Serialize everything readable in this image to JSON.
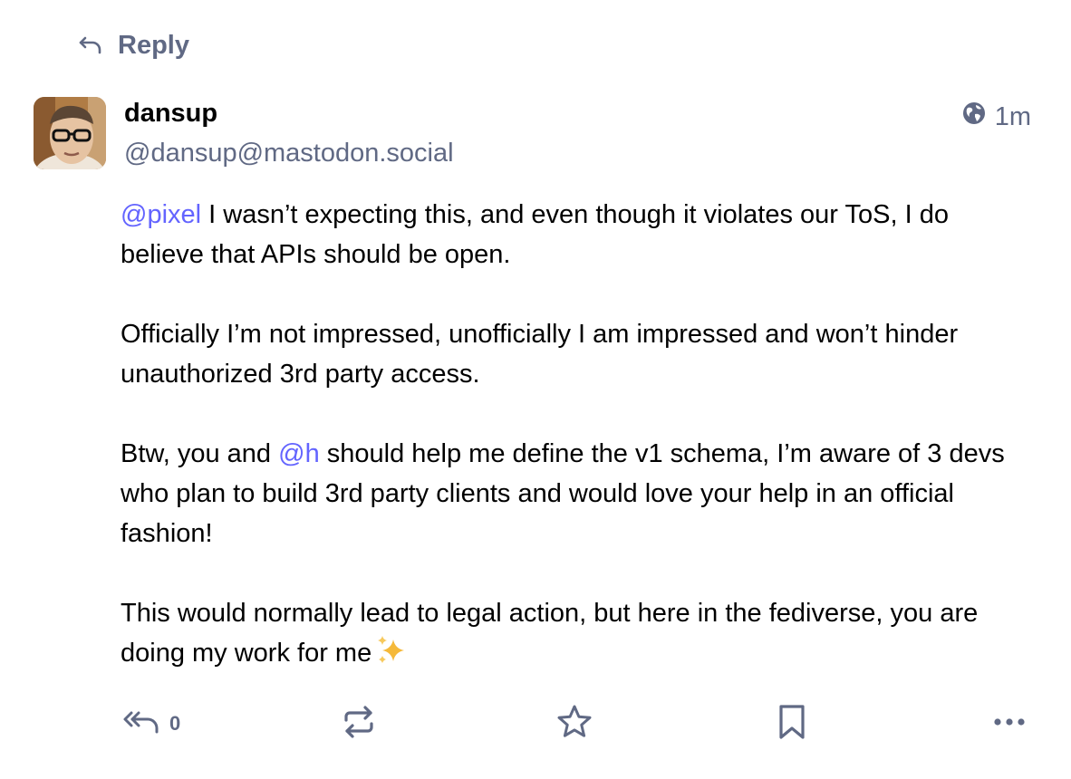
{
  "header": {
    "reply_label": "Reply",
    "reply_icon": "reply-arrow-icon"
  },
  "status": {
    "author": {
      "display_name": "dansup",
      "handle": "@dansup@mastodon.social",
      "avatar": "avatar-photo"
    },
    "visibility_icon": "globe-icon",
    "time_ago": "1m",
    "paragraphs": [
      {
        "mention": "@pixel",
        "text": " I wasn’t expecting this, and even though it violates our ToS, I do believe that APIs should be open."
      },
      {
        "text": "Officially I’m not impressed, unofficially I am impressed and won’t hinder unauthorized 3rd party access."
      },
      {
        "prefix": "Btw, you and ",
        "mention": "@h",
        "suffix": " should help me define the v1 schema, I’m aware of 3 devs who plan to build 3rd party clients and would love your help in an official fashion!"
      },
      {
        "text": "This would normally lead to legal action, but here in the fediverse, you are doing my work for me",
        "emoji": "sparkles-icon"
      }
    ]
  },
  "actions": {
    "reply_count": "0",
    "icons": [
      "reply-all-icon",
      "boost-icon",
      "star-icon",
      "bookmark-icon",
      "more-icon"
    ]
  },
  "colors": {
    "accent": "#6364ff",
    "muted": "#606984",
    "sparkle": "#f5b93a"
  }
}
